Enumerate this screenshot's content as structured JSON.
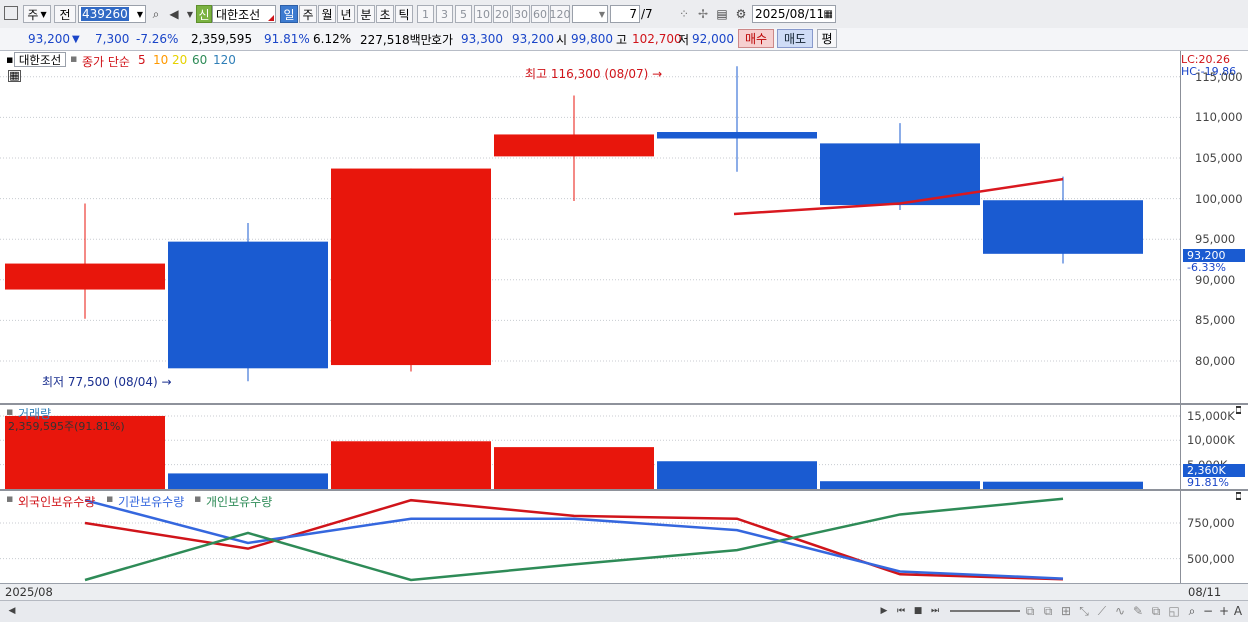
{
  "toolbar": {
    "period_btn": "주",
    "prev_btn": "전",
    "stock_code": "439260",
    "credit_tag": "신",
    "stock_name": "대한조선",
    "periods": [
      "일",
      "주",
      "월",
      "년",
      "분",
      "초",
      "틱"
    ],
    "active_period": "일",
    "intervals": [
      "1",
      "3",
      "5",
      "10",
      "20",
      "30",
      "60",
      "120"
    ],
    "count_current": "7",
    "count_total": "/7",
    "date": "2025/08/11"
  },
  "quote": {
    "price": "93,200",
    "change": "7,300",
    "change_pct": "-7.26%",
    "volume": "2,359,595",
    "volume_ratio": "91.81%",
    "turnover": "6.12%",
    "amount": "227,518백만",
    "bid_label": "호가",
    "bid": "93,300",
    "ask": "93,200",
    "open_label": "시",
    "open": "99,800",
    "high_label": "고",
    "high": "102,700",
    "low_label": "저",
    "low": "92,000",
    "buy_label": "매수",
    "sell_label": "매도",
    "eval_label": "평"
  },
  "colors": {
    "up": "#e8160c",
    "down": "#1a5bd1",
    "ma5": "#d9181f",
    "foreign": "#d0141a",
    "institution": "#3567de",
    "individual": "#2e8b57"
  },
  "price_panel": {
    "name_box": "대한조선",
    "legend_title": "종가 단순",
    "ma_periods": [
      "5",
      "10",
      "20",
      "60",
      "120"
    ],
    "ma_colors": [
      "#d0141a",
      "#ff9900",
      "#e6d200",
      "#2e8b57",
      "#2f7fb8"
    ],
    "lc_label": "LC:20.26",
    "hc_label": "HC:-19.86",
    "high_annotation": "최고 116,300 (08/07)",
    "low_annotation": "최저 77,500 (08/04)",
    "last_price_tag": "93,200",
    "last_pct_tag": "-6.33%",
    "y_ticks": [
      "115,000",
      "110,000",
      "105,000",
      "100,000",
      "95,000",
      "90,000",
      "85,000",
      "80,000"
    ]
  },
  "volume_panel": {
    "title": "거래량",
    "readout": "2,359,595주(91.81%)",
    "y_ticks": [
      "15,000K",
      "10,000K",
      "5,000K"
    ],
    "last_tag": "2,360K",
    "last_pct": "91.81%"
  },
  "holdings_panel": {
    "legend": [
      "외국인보유수량",
      "기관보유수량",
      "개인보유수량"
    ],
    "y_ticks": [
      "750,000",
      "500,000"
    ]
  },
  "x_axis": {
    "left_label": "2025/08",
    "right_label": "08/11"
  },
  "chart_data": [
    {
      "type": "candlestick",
      "y_ticks": [
        80000,
        85000,
        90000,
        95000,
        100000,
        105000,
        110000,
        115000
      ],
      "candles": [
        {
          "open": 92000,
          "close": 88800,
          "high": 99400,
          "low": 85200,
          "dir": "up"
        },
        {
          "open": 94700,
          "close": 79100,
          "high": 97000,
          "low": 77500,
          "dir": "down"
        },
        {
          "open": 79500,
          "close": 103700,
          "high": 103700,
          "low": 78700,
          "dir": "up"
        },
        {
          "open": 105200,
          "close": 107900,
          "high": 112700,
          "low": 99700,
          "dir": "up"
        },
        {
          "open": 108200,
          "close": 107400,
          "high": 116300,
          "low": 103300,
          "dir": "down"
        },
        {
          "open": 106800,
          "close": 99200,
          "high": 109300,
          "low": 98600,
          "dir": "down"
        },
        {
          "open": 99800,
          "close": 93200,
          "high": 102700,
          "low": 92000,
          "dir": "down"
        }
      ],
      "ma5": [
        null,
        null,
        null,
        null,
        98100,
        99400,
        102400
      ]
    },
    {
      "type": "bar",
      "y_ticks": [
        5000,
        10000,
        15000
      ],
      "unit": "K",
      "values": [
        15000,
        3200,
        9800,
        8600,
        5700,
        1600,
        1500
      ],
      "dirs": [
        "up",
        "down",
        "up",
        "up",
        "down",
        "down",
        "down"
      ]
    },
    {
      "type": "line",
      "y_ticks": [
        500000,
        750000
      ],
      "series": [
        {
          "name": "외국인보유수량",
          "values": [
            750000,
            570000,
            910000,
            800000,
            780000,
            390000,
            355000
          ]
        },
        {
          "name": "기관보유수량",
          "values": [
            910000,
            610000,
            780000,
            780000,
            700000,
            410000,
            360000
          ]
        },
        {
          "name": "개인보유수량",
          "values": [
            350000,
            680000,
            350000,
            460000,
            560000,
            810000,
            920000
          ]
        }
      ]
    }
  ]
}
